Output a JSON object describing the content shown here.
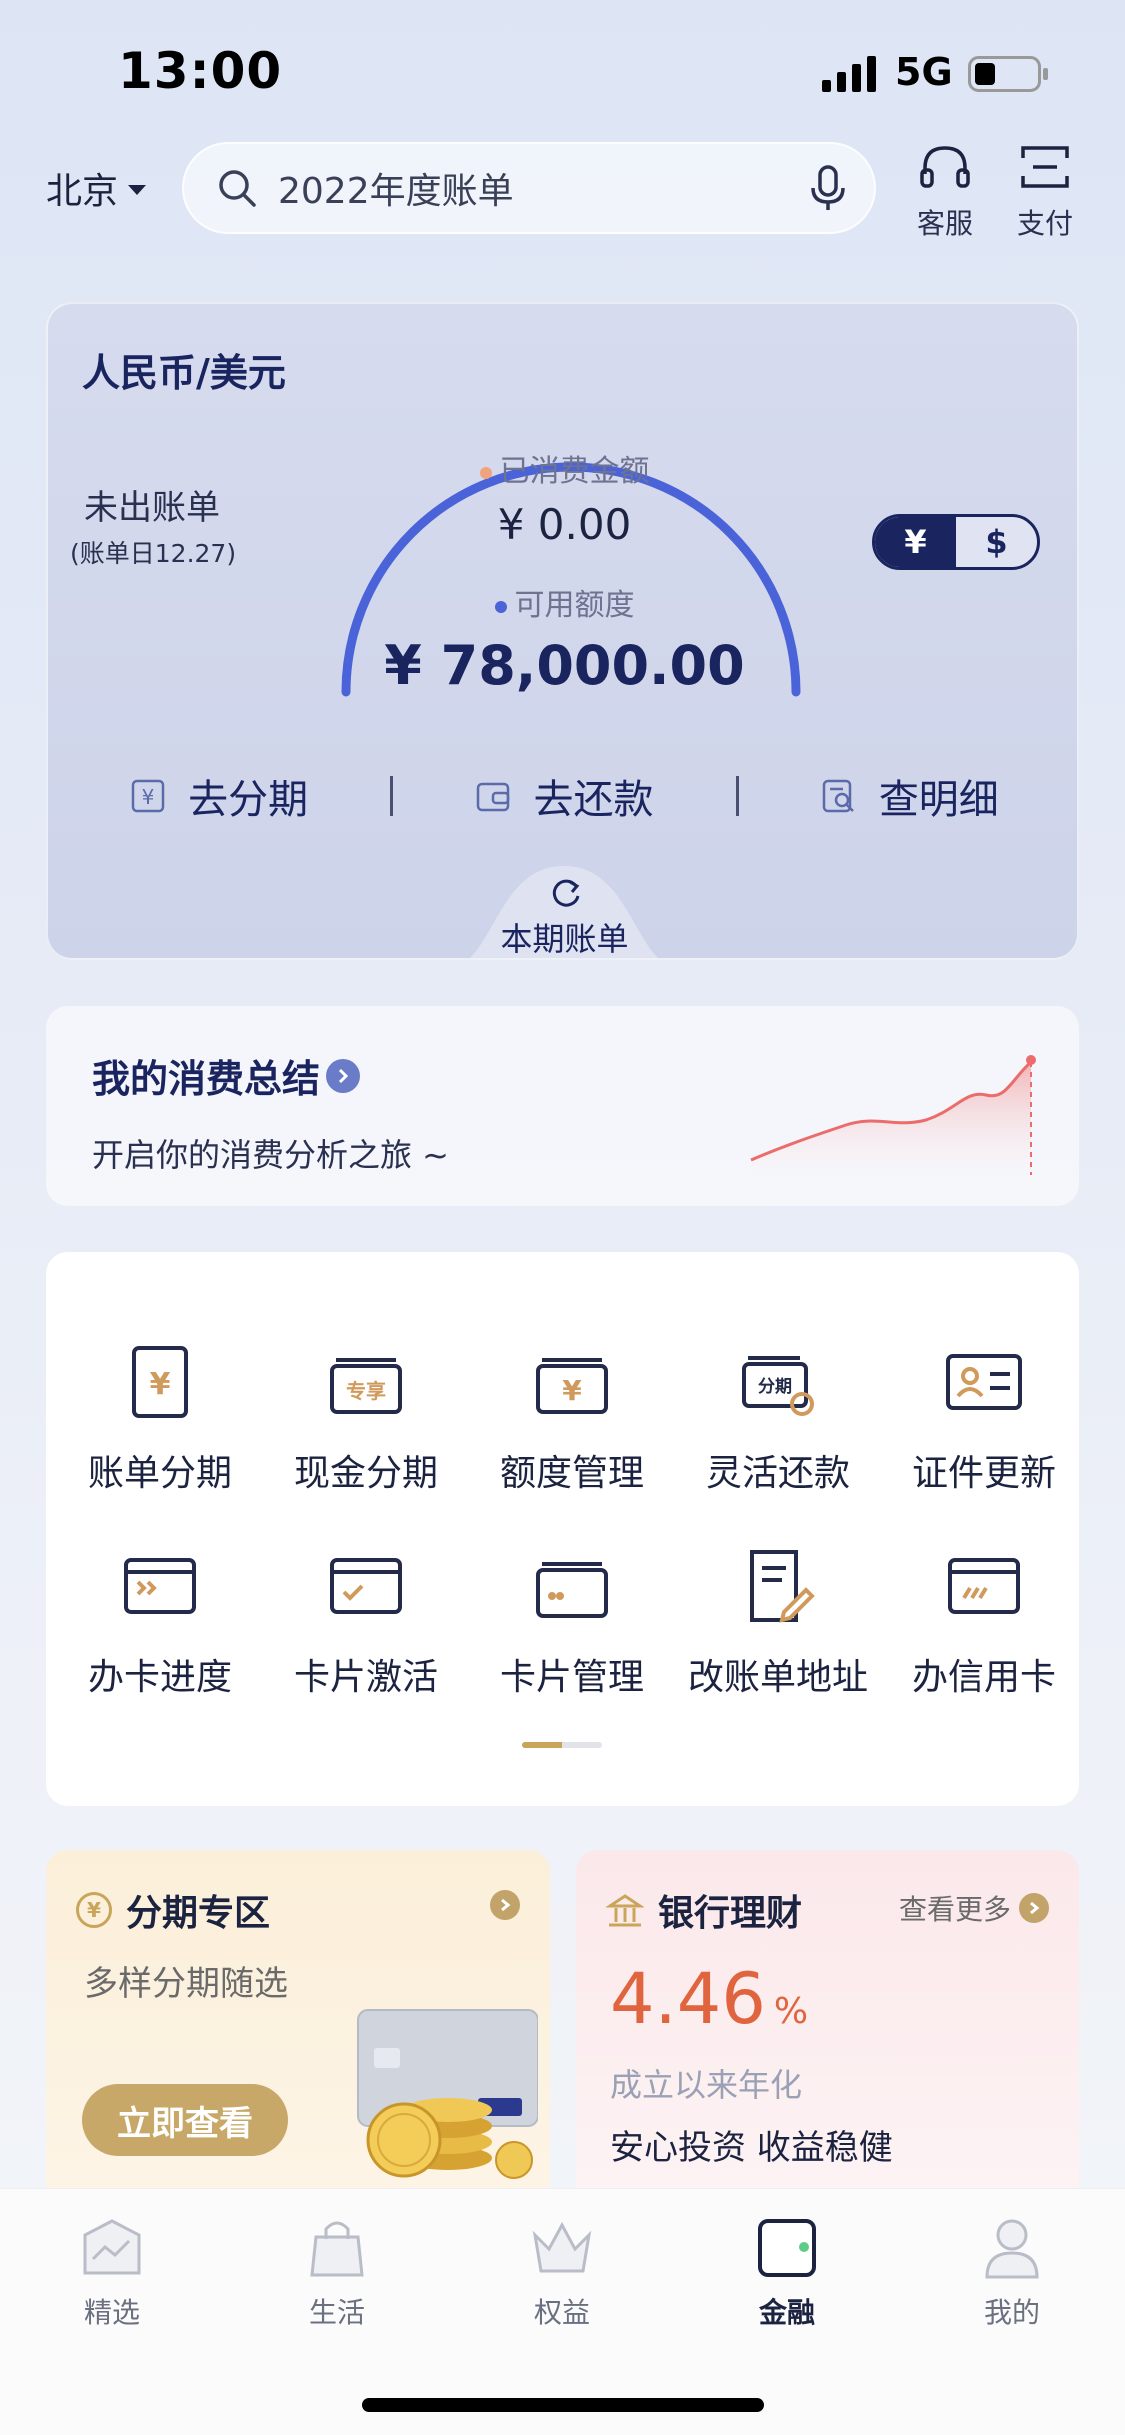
{
  "status": {
    "time": "13:00",
    "network": "5G"
  },
  "header": {
    "city": "北京",
    "search_placeholder": "2022年度账单",
    "service_label": "客服",
    "pay_label": "支付"
  },
  "card": {
    "currency_title": "人民币/美元",
    "unbilled_label": "未出账单",
    "bill_date": "(账单日12.27)",
    "spent_label": "已消费金额",
    "spent_value": "¥ 0.00",
    "available_label": "可用额度",
    "available_value": "¥ 78,000.00",
    "currency_cny": "¥",
    "currency_usd": "$",
    "actions": [
      {
        "label": "去分期",
        "icon": "installment-icon"
      },
      {
        "label": "去还款",
        "icon": "wallet-icon"
      },
      {
        "label": "查明细",
        "icon": "detail-search-icon"
      }
    ],
    "period_tab": "本期账单",
    "colors": {
      "gauge": "#4a63d8",
      "spent_dot": "#f1a37c",
      "accent": "#1a2560"
    }
  },
  "summary": {
    "title": "我的消费总结",
    "subtitle": "开启你的消费分析之旅 ~"
  },
  "services": {
    "row1": [
      {
        "label": "账单分期",
        "icon": "bill-installment-icon"
      },
      {
        "label": "现金分期",
        "icon": "cash-installment-icon"
      },
      {
        "label": "额度管理",
        "icon": "limit-management-icon"
      },
      {
        "label": "灵活还款",
        "icon": "flexible-repay-icon"
      },
      {
        "label": "证件更新",
        "icon": "id-update-icon"
      }
    ],
    "row2": [
      {
        "label": "办卡进度",
        "icon": "card-progress-icon"
      },
      {
        "label": "卡片激活",
        "icon": "card-activate-icon"
      },
      {
        "label": "卡片管理",
        "icon": "card-manage-icon"
      },
      {
        "label": "改账单地址",
        "icon": "bill-address-icon"
      },
      {
        "label": "办信用卡",
        "icon": "apply-card-icon"
      }
    ],
    "badge_exclusive": "专享",
    "badge_installment": "分期"
  },
  "promo_installment": {
    "title": "分期专区",
    "subtitle": "多样分期随选",
    "button": "立即查看"
  },
  "promo_wealth": {
    "title": "银行理财",
    "more": "查看更多",
    "rate": "4.46",
    "rate_unit": "%",
    "rate_desc": "成立以来年化",
    "slogan": "安心投资 收益稳健"
  },
  "tabbar": {
    "items": [
      {
        "label": "精选",
        "icon": "featured-icon"
      },
      {
        "label": "生活",
        "icon": "life-bag-icon"
      },
      {
        "label": "权益",
        "icon": "crown-icon"
      },
      {
        "label": "金融",
        "icon": "finance-wallet-icon",
        "active": true
      },
      {
        "label": "我的",
        "icon": "profile-icon"
      }
    ]
  }
}
